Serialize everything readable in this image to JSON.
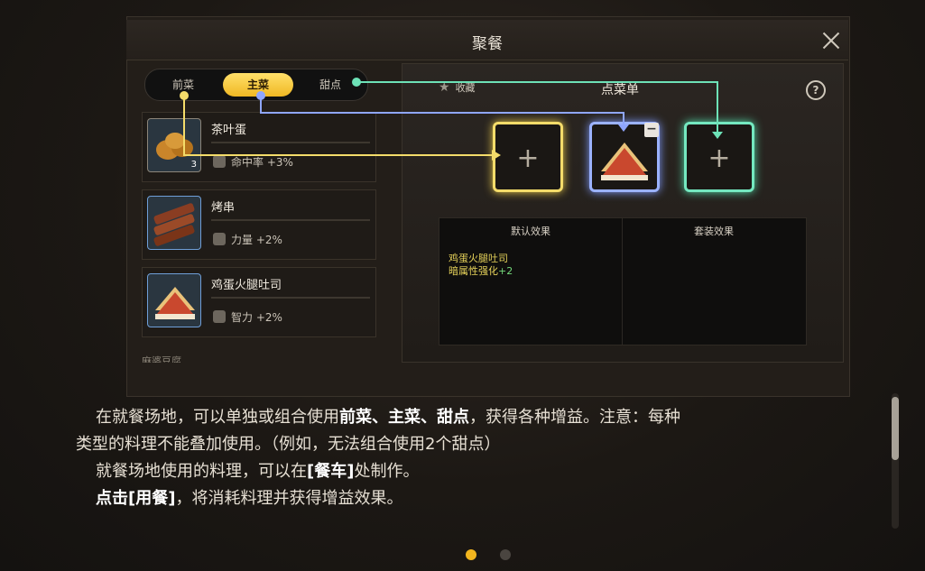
{
  "window": {
    "title": "聚餐"
  },
  "tabs": [
    {
      "label": "前菜",
      "active": false
    },
    {
      "label": "主菜",
      "active": true
    },
    {
      "label": "甜点",
      "active": false
    }
  ],
  "dishes": [
    {
      "name": "茶叶蛋",
      "effect": "命中率 +3%",
      "count": "3",
      "icon": "tea-egg-icon"
    },
    {
      "name": "烤串",
      "effect": "力量 +2%",
      "icon": "skewer-icon"
    },
    {
      "name": "鸡蛋火腿吐司",
      "effect": "智力 +2%",
      "icon": "sandwich-icon"
    },
    {
      "name": "麻婆豆腐",
      "effect": ""
    }
  ],
  "menu": {
    "favorite_label": "收藏",
    "title": "点菜单",
    "help_label": "?"
  },
  "slots": [
    {
      "type": "前菜",
      "filled": false,
      "plus": "+"
    },
    {
      "type": "主菜",
      "filled": true,
      "item": "鸡蛋火腿吐司",
      "remove": "−"
    },
    {
      "type": "甜点",
      "filled": false,
      "plus": "+"
    }
  ],
  "effects": {
    "default_label": "默认效果",
    "set_label": "套装效果",
    "default_name": "鸡蛋火腿吐司",
    "default_attr": "暗属性强化",
    "default_bonus": "+2"
  },
  "description": {
    "p1_a": "在就餐场地，可以单独或组合使用",
    "p1_h": "前菜、主菜、甜点",
    "p1_b": "，获得各种增益。注意：每种",
    "p1_c": "类型的料理不能叠加使用。（例如，无法组合使用2个甜点）",
    "p2_a": "就餐场地使用的料理，可以在",
    "p2_h": "[餐车]",
    "p2_b": "处制作。",
    "p3_h": "点击[用餐]",
    "p3_b": "，将消耗料理并获得增益效果。"
  },
  "pager": {
    "current": 1,
    "total": 2
  },
  "colors": {
    "gold": "#f4dc6a",
    "blue": "#9bb2ff",
    "teal": "#74e8c0"
  }
}
